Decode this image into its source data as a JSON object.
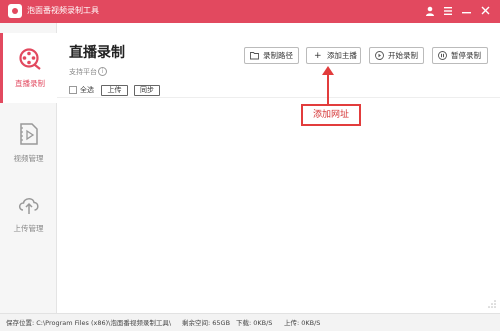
{
  "window": {
    "title": "泡面番视频录制工具",
    "user_icon": "user-icon",
    "menu_icon": "menu-icon",
    "minimize_icon": "minimize-icon",
    "close_icon": "close-icon"
  },
  "sidebar": {
    "items": [
      {
        "label": "直播录制",
        "icon": "film-reel-icon",
        "active": true
      },
      {
        "label": "视频管理",
        "icon": "video-file-icon",
        "active": false
      },
      {
        "label": "上传管理",
        "icon": "cloud-upload-icon",
        "active": false
      }
    ]
  },
  "main": {
    "title": "直播录制",
    "subtitle": "支持平台",
    "info_icon": "i",
    "buttons": {
      "record_path": "录制路径",
      "add_host": "添加主播",
      "start_record": "开始录制",
      "pause_record": "暂停录制",
      "add_prefix": "+"
    },
    "select_all": "全选",
    "upload": "上传",
    "sync": "同步"
  },
  "annotation": {
    "label": "添加网址"
  },
  "status": {
    "save_location": "保存位置: C:\\Program Files (x86)\\泡面番视频录制工具\\",
    "free_space": "剩余空间: 65GB",
    "download": "下载: 0KB/S",
    "upload": "上传: 0KB/S"
  },
  "colors": {
    "accent": "#e2495f",
    "callout": "#e23c3c"
  }
}
